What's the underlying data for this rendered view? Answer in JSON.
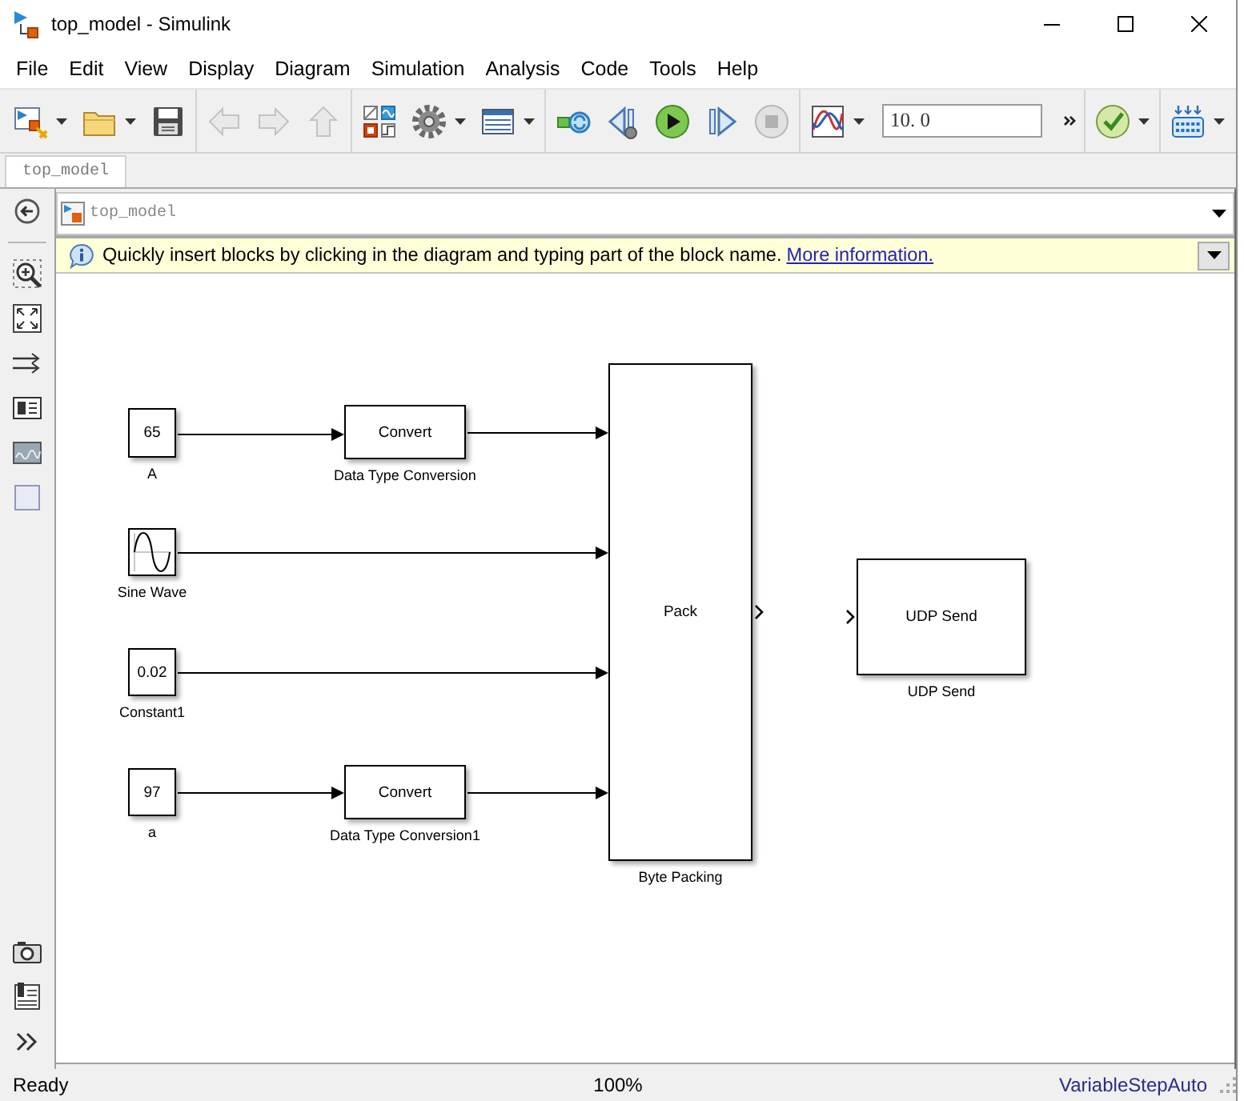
{
  "window": {
    "title": "top_model - Simulink"
  },
  "menu": [
    "File",
    "Edit",
    "View",
    "Display",
    "Diagram",
    "Simulation",
    "Analysis",
    "Code",
    "Tools",
    "Help"
  ],
  "toolbar": {
    "groups": [
      {
        "buttons": [
          {
            "kind": "new_model",
            "disabled": false,
            "dropdown": true
          },
          {
            "kind": "open",
            "disabled": false,
            "dropdown": true
          },
          {
            "kind": "save",
            "disabled": false,
            "dropdown": false
          }
        ]
      },
      {
        "buttons": [
          {
            "kind": "back",
            "disabled": true,
            "dropdown": false
          },
          {
            "kind": "forward",
            "disabled": true,
            "dropdown": false
          },
          {
            "kind": "up",
            "disabled": true,
            "dropdown": false
          }
        ]
      },
      {
        "buttons": [
          {
            "kind": "library",
            "disabled": false,
            "dropdown": false
          },
          {
            "kind": "settings",
            "disabled": false,
            "dropdown": true
          },
          {
            "kind": "explorer",
            "disabled": false,
            "dropdown": true
          }
        ]
      },
      {
        "buttons": [
          {
            "kind": "update",
            "disabled": false,
            "dropdown": false
          },
          {
            "kind": "step_back",
            "disabled": false,
            "dropdown": false
          },
          {
            "kind": "run",
            "disabled": false,
            "dropdown": false
          },
          {
            "kind": "step_forward",
            "disabled": false,
            "dropdown": false
          },
          {
            "kind": "stop",
            "disabled": true,
            "dropdown": false
          }
        ]
      },
      {
        "buttons": [
          {
            "kind": "scope",
            "disabled": false,
            "dropdown": true
          }
        ],
        "stop_time": "10. 0"
      },
      {
        "buttons": [
          {
            "kind": "check",
            "disabled": false,
            "dropdown": true
          }
        ]
      },
      {
        "buttons": [
          {
            "kind": "grid",
            "disabled": false,
            "dropdown": true
          }
        ]
      }
    ]
  },
  "tabs": [
    {
      "label": "top_model",
      "selected": true
    }
  ],
  "breadcrumb": {
    "label": "top_model"
  },
  "info_bar": {
    "text": "Quickly insert blocks by clicking in the diagram and typing part of the block name.",
    "link": "More information."
  },
  "diagram": {
    "blocks": [
      {
        "kind": "constant",
        "text": "65",
        "label": "A"
      },
      {
        "kind": "convert",
        "text": "Convert",
        "label": "Data Type Conversion"
      },
      {
        "kind": "sine",
        "label": "Sine Wave"
      },
      {
        "kind": "constant",
        "text": "0.02",
        "label": "Constant1"
      },
      {
        "kind": "constant",
        "text": "97",
        "label": "a"
      },
      {
        "kind": "convert",
        "text": "Convert",
        "label": "Data Type Conversion1"
      },
      {
        "kind": "byte_pack",
        "text": "Pack",
        "label": "Byte Packing"
      },
      {
        "kind": "udp_send",
        "text": "UDP Send",
        "label": "UDP Send"
      }
    ]
  },
  "status_bar": {
    "state": "Ready",
    "zoom": "100%",
    "solver": "VariableStepAuto"
  }
}
